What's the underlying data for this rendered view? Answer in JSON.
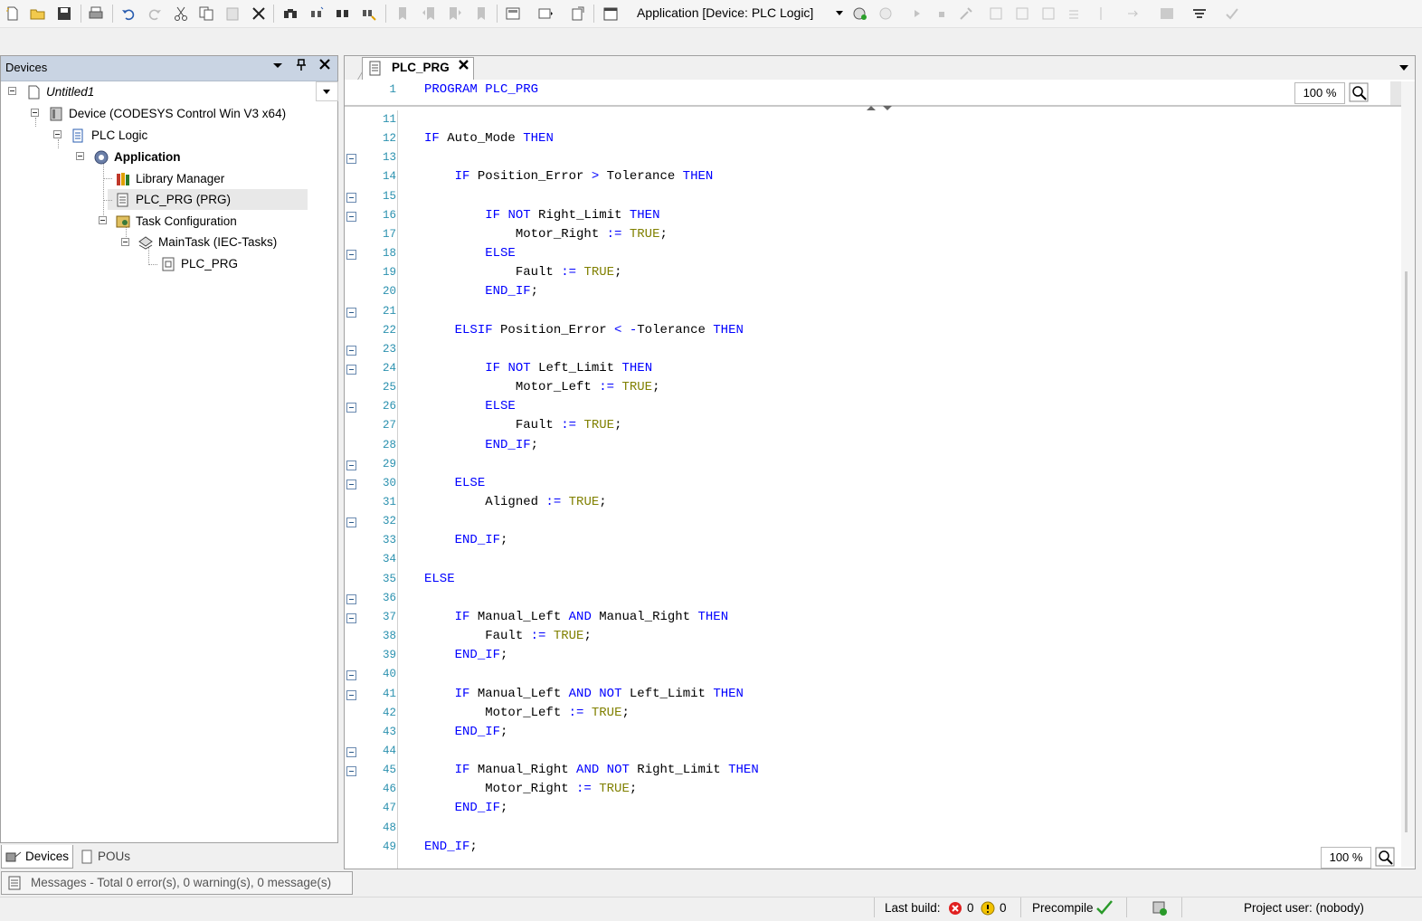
{
  "toolbar": {
    "active_application": "Application [Device: PLC Logic]",
    "buttons": [
      "new-file-icon",
      "open-folder-icon",
      "save-icon",
      "print-icon",
      "undo-icon",
      "redo-icon",
      "cut-icon",
      "copy-icon",
      "paste-icon",
      "delete-icon",
      "find-icon",
      "find-next-icon",
      "find-in-project-icon",
      "replace-icon",
      "bookmark-icon",
      "prev-bookmark-icon",
      "next-bookmark-icon",
      "clear-bookmarks-icon",
      "add-object-icon",
      "insert-icon",
      "open-icon",
      "calendar-icon"
    ]
  },
  "devices_panel": {
    "title": "Devices",
    "tree": [
      {
        "label": "Untitled1"
      },
      {
        "label": "Device (CODESYS Control Win V3 x64)"
      },
      {
        "label": "PLC Logic"
      },
      {
        "label": "Application"
      },
      {
        "label": "Library Manager"
      },
      {
        "label": "PLC_PRG (PRG)"
      },
      {
        "label": "Task Configuration"
      },
      {
        "label": "MainTask (IEC-Tasks)"
      },
      {
        "label": "PLC_PRG"
      }
    ],
    "tabs": {
      "devices": "Devices",
      "pous": "POUs"
    }
  },
  "editor": {
    "tab_label": "PLC_PRG",
    "zoom_top": "100 %",
    "zoom_bottom": "100 %",
    "declaration": {
      "line_number": "1",
      "text": "PROGRAM PLC_PRG"
    },
    "lines": [
      {
        "n": "11",
        "t": ""
      },
      {
        "n": "12",
        "t": "IF Auto_Mode THEN"
      },
      {
        "n": "13",
        "t": ""
      },
      {
        "n": "14",
        "t": "    IF Position_Error > Tolerance THEN"
      },
      {
        "n": "15",
        "t": ""
      },
      {
        "n": "16",
        "t": "        IF NOT Right_Limit THEN"
      },
      {
        "n": "17",
        "t": "            Motor_Right := TRUE;"
      },
      {
        "n": "18",
        "t": "        ELSE"
      },
      {
        "n": "19",
        "t": "            Fault := TRUE;"
      },
      {
        "n": "20",
        "t": "        END_IF;"
      },
      {
        "n": "21",
        "t": ""
      },
      {
        "n": "22",
        "t": "    ELSIF Position_Error < -Tolerance THEN"
      },
      {
        "n": "23",
        "t": ""
      },
      {
        "n": "24",
        "t": "        IF NOT Left_Limit THEN"
      },
      {
        "n": "25",
        "t": "            Motor_Left := TRUE;"
      },
      {
        "n": "26",
        "t": "        ELSE"
      },
      {
        "n": "27",
        "t": "            Fault := TRUE;"
      },
      {
        "n": "28",
        "t": "        END_IF;"
      },
      {
        "n": "29",
        "t": ""
      },
      {
        "n": "30",
        "t": "    ELSE"
      },
      {
        "n": "31",
        "t": "        Aligned := TRUE;"
      },
      {
        "n": "32",
        "t": ""
      },
      {
        "n": "33",
        "t": "    END_IF;"
      },
      {
        "n": "34",
        "t": ""
      },
      {
        "n": "35",
        "t": "ELSE"
      },
      {
        "n": "36",
        "t": ""
      },
      {
        "n": "37",
        "t": "    IF Manual_Left AND Manual_Right THEN"
      },
      {
        "n": "38",
        "t": "        Fault := TRUE;"
      },
      {
        "n": "39",
        "t": "    END_IF;"
      },
      {
        "n": "40",
        "t": ""
      },
      {
        "n": "41",
        "t": "    IF Manual_Left AND NOT Left_Limit THEN"
      },
      {
        "n": "42",
        "t": "        Motor_Left := TRUE;"
      },
      {
        "n": "43",
        "t": "    END_IF;"
      },
      {
        "n": "44",
        "t": ""
      },
      {
        "n": "45",
        "t": "    IF Manual_Right AND NOT Right_Limit THEN"
      },
      {
        "n": "46",
        "t": "        Motor_Right := TRUE;"
      },
      {
        "n": "47",
        "t": "    END_IF;"
      },
      {
        "n": "48",
        "t": ""
      },
      {
        "n": "49",
        "t": "END_IF;"
      }
    ],
    "folds": [
      "13",
      "15",
      "16",
      "18",
      "21",
      "23",
      "24",
      "26",
      "29",
      "30",
      "32",
      "36",
      "37",
      "40",
      "41",
      "44",
      "45"
    ],
    "colors": {
      "keyword": "#0000ff",
      "literal": "#808000",
      "line_number": "#2b91af"
    }
  },
  "messages": {
    "label": "Messages - Total 0 error(s), 0 warning(s), 0 message(s)"
  },
  "statusbar": {
    "last_build_label": "Last build:",
    "errors": "0",
    "warnings": "0",
    "precompile": "Precompile",
    "project_user": "Project user: (nobody)"
  }
}
